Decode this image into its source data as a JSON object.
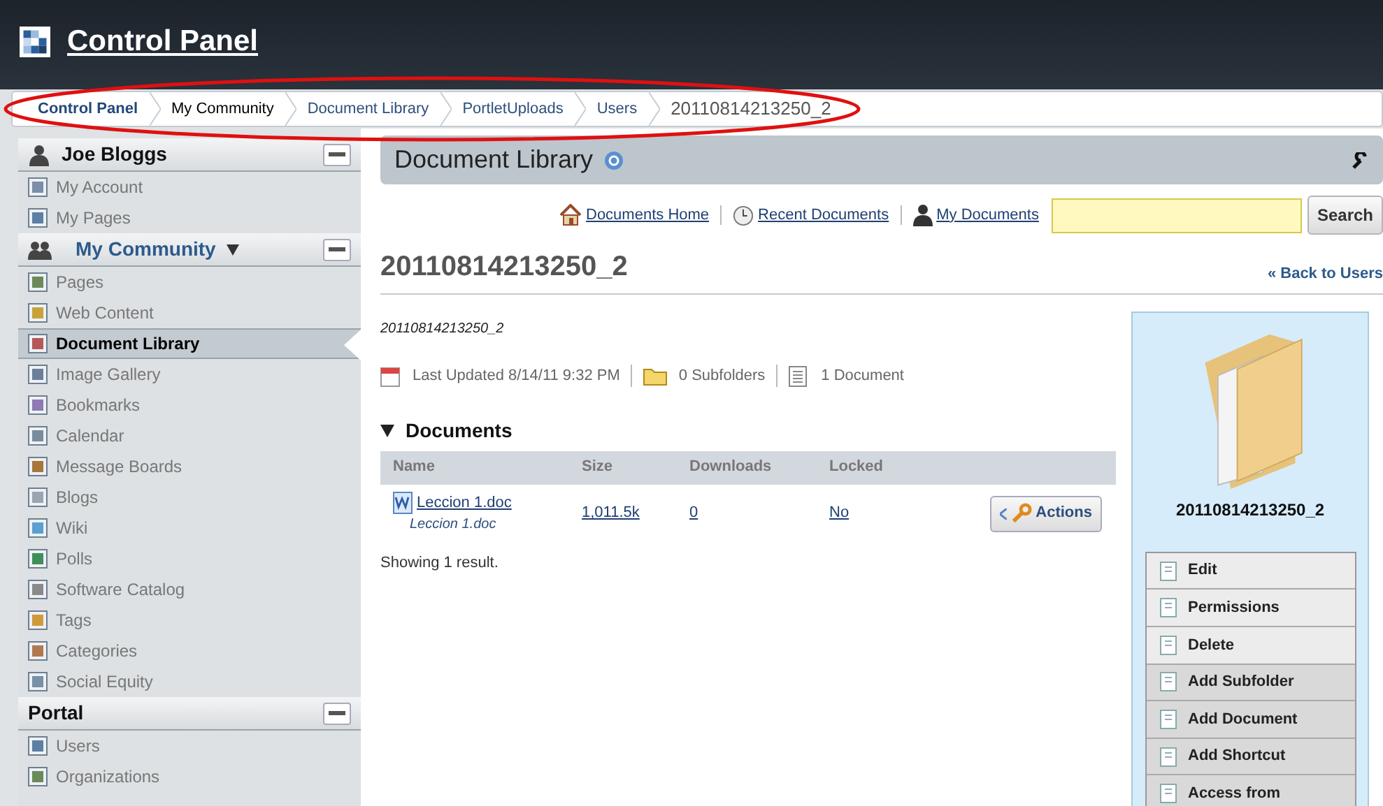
{
  "header": {
    "title": "Control Panel"
  },
  "breadcrumbs": [
    {
      "label": "Control Panel",
      "kind": "root"
    },
    {
      "label": "My Community",
      "kind": "plain"
    },
    {
      "label": "Document Library",
      "kind": "link"
    },
    {
      "label": "PortletUploads",
      "kind": "link"
    },
    {
      "label": "Users",
      "kind": "link"
    },
    {
      "label": "20110814213250_2",
      "kind": "current"
    }
  ],
  "sidebar": {
    "sections": [
      {
        "title": "Joe Bloggs",
        "kind": "user",
        "items": [
          {
            "label": "My Account",
            "selected": false
          },
          {
            "label": "My Pages",
            "selected": false
          }
        ]
      },
      {
        "title": "My Community",
        "kind": "community",
        "items": [
          {
            "label": "Pages",
            "selected": false
          },
          {
            "label": "Web Content",
            "selected": false
          },
          {
            "label": "Document Library",
            "selected": true
          },
          {
            "label": "Image Gallery",
            "selected": false
          },
          {
            "label": "Bookmarks",
            "selected": false
          },
          {
            "label": "Calendar",
            "selected": false
          },
          {
            "label": "Message Boards",
            "selected": false
          },
          {
            "label": "Blogs",
            "selected": false
          },
          {
            "label": "Wiki",
            "selected": false
          },
          {
            "label": "Polls",
            "selected": false
          },
          {
            "label": "Software Catalog",
            "selected": false
          },
          {
            "label": "Tags",
            "selected": false
          },
          {
            "label": "Categories",
            "selected": false
          },
          {
            "label": "Social Equity",
            "selected": false
          }
        ]
      },
      {
        "title": "Portal",
        "kind": "plain",
        "items": [
          {
            "label": "Users",
            "selected": false
          },
          {
            "label": "Organizations",
            "selected": false
          }
        ]
      }
    ]
  },
  "portlet": {
    "title": "Document Library"
  },
  "nav_links": [
    {
      "label": "Documents Home",
      "kind": "home"
    },
    {
      "label": "Recent Documents",
      "kind": "recent"
    },
    {
      "label": "My Documents",
      "kind": "mine"
    }
  ],
  "search": {
    "button": "Search"
  },
  "folder": {
    "title": "20110814213250_2",
    "back_link": "« Back to Users",
    "description": "20110814213250_2",
    "last_updated": "Last Updated 8/14/11 9:32 PM",
    "subfolders": "0 Subfolders",
    "documents_count": "1 Document"
  },
  "documents": {
    "title": "Documents",
    "columns": [
      "Name",
      "Size",
      "Downloads",
      "Locked"
    ],
    "rows": [
      {
        "name": "Leccion 1.doc",
        "subtitle": "Leccion 1.doc",
        "size": "1,011.5k",
        "downloads": "0",
        "locked": "No",
        "action": "Actions"
      }
    ],
    "result_text": "Showing 1 result."
  },
  "side_panel": {
    "folder_name": "20110814213250_2",
    "actions": [
      "Edit",
      "Permissions",
      "Delete",
      "Add Subfolder",
      "Add Document",
      "Add Shortcut",
      "Access from"
    ]
  }
}
